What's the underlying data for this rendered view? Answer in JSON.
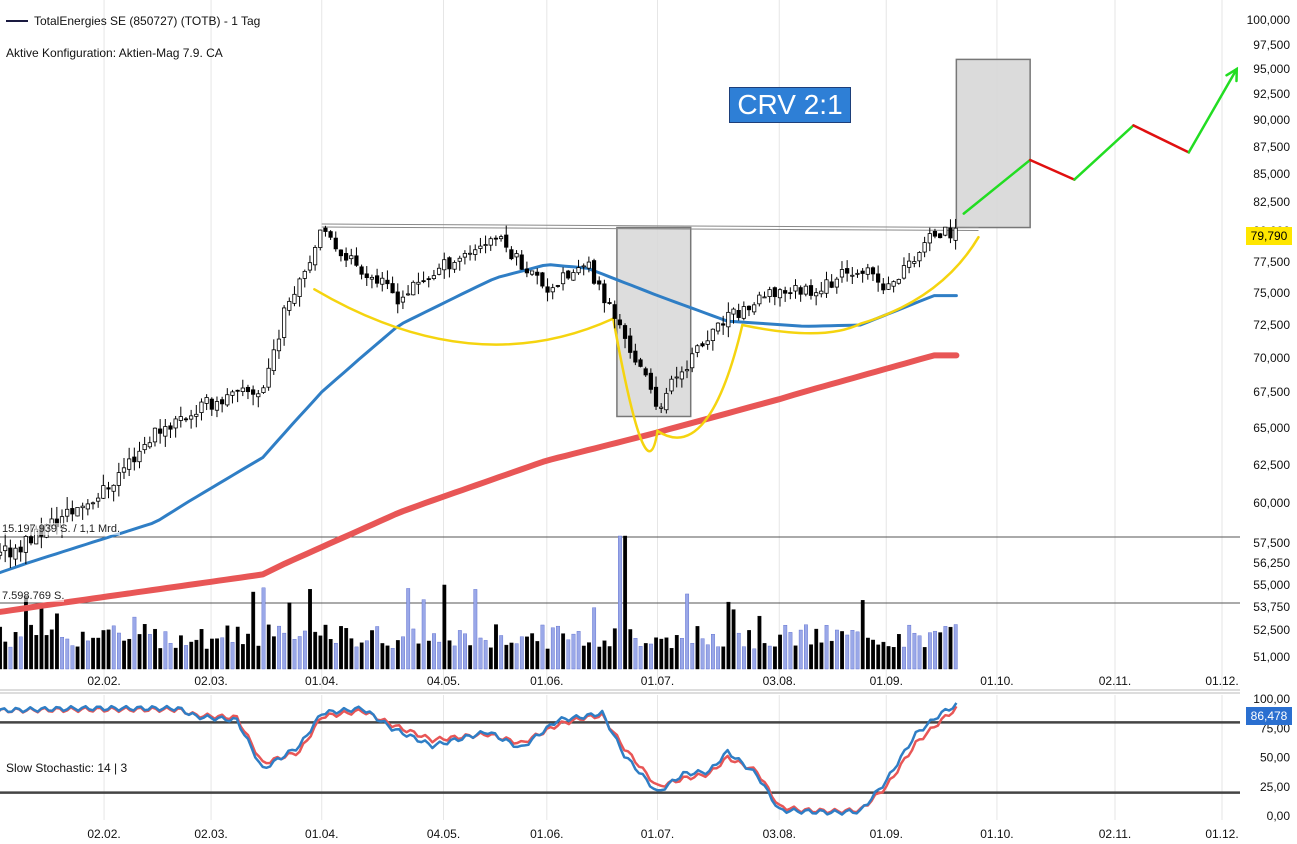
{
  "header": {
    "instrument": "TotalEnergies SE (850727) (TOTB) - 1 Tag",
    "config": "Aktive Konfiguration: Aktien-Mag 7.9. CA"
  },
  "annotation": {
    "crv": "CRV 2:1"
  },
  "price_tag": "79,790",
  "stoch_tag": "86,478",
  "stoch_label": "Slow Stochastic: 14 | 3",
  "volume": {
    "label_high": "15.197.939 S. / 1,1 Mrd.",
    "label_mid": "7.598.769 S."
  },
  "colors": {
    "sma_blue": "#2f7ec5",
    "sma_red": "#e85656",
    "cup": "#f5d40f",
    "target_up": "#22dd22",
    "target_down": "#e01010",
    "stoch_k": "#2f7ec5",
    "stoch_d": "#e85656",
    "vol_up": "#9aa8e8",
    "vol_down": "#000000",
    "price_tag_bg": "#ffe600",
    "stoch_tag_bg": "#2a6fd0"
  },
  "chart_data": [
    {
      "type": "candlestick",
      "title": "TotalEnergies SE (850727) (TOTB) - 1 Tag",
      "x_ticks": [
        "02.02.",
        "02.03.",
        "01.04.",
        "04.05.",
        "01.06.",
        "01.07.",
        "03.08.",
        "01.09.",
        "01.10.",
        "02.11.",
        "01.12."
      ],
      "y_ticks": [
        "100,000",
        "97,500",
        "95,000",
        "92,500",
        "90,000",
        "87,500",
        "85,000",
        "82,500",
        "80,000",
        "77,500",
        "75,000",
        "72,500",
        "70,000",
        "67,500",
        "65,000",
        "62,500",
        "60,000",
        "57,500",
        "56,250",
        "55,000",
        "53,750",
        "52,500",
        "51,000"
      ],
      "last_price": 79.79,
      "close_keypoints": [
        [
          "02.01.",
          56.2
        ],
        [
          "02.02.",
          60.8
        ],
        [
          "16.02.",
          64.8
        ],
        [
          "02.03.",
          66.8
        ],
        [
          "16.03.",
          67.7
        ],
        [
          "23.03.",
          74.5
        ],
        [
          "01.04.",
          79.8
        ],
        [
          "11.04.",
          77.2
        ],
        [
          "22.04.",
          74.6
        ],
        [
          "04.05.",
          77.2
        ],
        [
          "18.05.",
          79.6
        ],
        [
          "01.06.",
          75.4
        ],
        [
          "12.06.",
          77.2
        ],
        [
          "20.06.",
          72.8
        ],
        [
          "01.07.",
          66.5
        ],
        [
          "08.07.",
          69.4
        ],
        [
          "20.07.",
          73.0
        ],
        [
          "03.08.",
          75.2
        ],
        [
          "14.08.",
          75.4
        ],
        [
          "25.08.",
          77.2
        ],
        [
          "01.09.",
          75.2
        ],
        [
          "14.09.",
          79.8
        ]
      ],
      "resistance": {
        "from": [
          "01.04.",
          80.6
        ],
        "to": [
          "20.09.",
          80.3
        ]
      },
      "sma_blue_keypoints": [
        [
          "02.01.",
          55.5
        ],
        [
          "16.02.",
          58.8
        ],
        [
          "16.03.",
          63.0
        ],
        [
          "01.04.",
          67.5
        ],
        [
          "22.04.",
          72.5
        ],
        [
          "18.05.",
          76.2
        ],
        [
          "01.06.",
          77.3
        ],
        [
          "12.06.",
          77.0
        ],
        [
          "01.07.",
          74.8
        ],
        [
          "20.07.",
          72.8
        ],
        [
          "10.08.",
          72.4
        ],
        [
          "25.08.",
          72.5
        ],
        [
          "14.09.",
          74.8
        ]
      ],
      "sma_red_keypoints": [
        [
          "02.01.",
          53.4
        ],
        [
          "16.03.",
          55.6
        ],
        [
          "22.04.",
          59.4
        ],
        [
          "01.06.",
          62.8
        ],
        [
          "01.07.",
          64.7
        ],
        [
          "03.08.",
          67.0
        ],
        [
          "14.09.",
          70.2
        ]
      ],
      "target_box": {
        "from": "20.09.",
        "to": "10.10.",
        "low": 80.3,
        "high": 96.0
      },
      "consolidation_box": {
        "from": "20.06.",
        "to": "10.07.",
        "low": 65.8,
        "high": 80.3
      },
      "target_path": [
        [
          "22.09.",
          81.5,
          "up"
        ],
        [
          "10.10.",
          86.3,
          "down"
        ],
        [
          "22.10.",
          84.5,
          "up"
        ],
        [
          "07.11.",
          89.5,
          "down"
        ],
        [
          "22.11.",
          87.0,
          "up"
        ],
        [
          "05.12.",
          95.0,
          "up"
        ]
      ]
    },
    {
      "type": "bar",
      "title": "Volume",
      "levels": [
        "15.197.939 S. / 1,1 Mrd.",
        "7.598.769 S."
      ]
    },
    {
      "type": "line",
      "title": "Slow Stochastic: 14 | 3",
      "x_ticks": [
        "02.02.",
        "02.03.",
        "01.04.",
        "04.05.",
        "01.06.",
        "01.07.",
        "03.08.",
        "01.09.",
        "01.10.",
        "02.11.",
        "01.12."
      ],
      "y_ticks": [
        "100,00",
        "75,00",
        "50,00",
        "25,00",
        "0,00"
      ],
      "y_range": [
        0,
        100
      ],
      "guide_levels": [
        80,
        20
      ],
      "last_value": 86.478,
      "k_keypoints": [
        [
          "02.01.",
          90
        ],
        [
          "26.01.",
          92
        ],
        [
          "22.02.",
          92
        ],
        [
          "27.02.",
          85
        ],
        [
          "09.03.",
          82
        ],
        [
          "16.03.",
          40
        ],
        [
          "26.03.",
          60
        ],
        [
          "01.04.",
          88
        ],
        [
          "12.04.",
          92
        ],
        [
          "20.04.",
          75
        ],
        [
          "01.05.",
          60
        ],
        [
          "16.05.",
          72
        ],
        [
          "25.05.",
          58
        ],
        [
          "04.06.",
          82
        ],
        [
          "11.06.",
          85
        ],
        [
          "16.06.",
          88
        ],
        [
          "22.06.",
          52
        ],
        [
          "01.07.",
          20
        ],
        [
          "08.07.",
          36
        ],
        [
          "15.07.",
          38
        ],
        [
          "20.07.",
          55
        ],
        [
          "28.07.",
          35
        ],
        [
          "03.08.",
          5
        ],
        [
          "09.08.",
          4
        ],
        [
          "18.08.",
          3
        ],
        [
          "25.08.",
          4
        ],
        [
          "01.09.",
          30
        ],
        [
          "09.09.",
          70
        ],
        [
          "16.09.",
          88
        ],
        [
          "20.09.",
          95
        ]
      ],
      "d_keypoints": [
        [
          "02.01.",
          90
        ],
        [
          "26.01.",
          91
        ],
        [
          "22.02.",
          91
        ],
        [
          "27.02.",
          86
        ],
        [
          "09.03.",
          84
        ],
        [
          "16.03.",
          45
        ],
        [
          "26.03.",
          55
        ],
        [
          "01.04.",
          85
        ],
        [
          "12.04.",
          90
        ],
        [
          "20.04.",
          78
        ],
        [
          "01.05.",
          65
        ],
        [
          "16.05.",
          70
        ],
        [
          "25.05.",
          62
        ],
        [
          "04.06.",
          78
        ],
        [
          "11.06.",
          84
        ],
        [
          "16.06.",
          86
        ],
        [
          "22.06.",
          58
        ],
        [
          "01.07.",
          25
        ],
        [
          "08.07.",
          32
        ],
        [
          "15.07.",
          36
        ],
        [
          "20.07.",
          50
        ],
        [
          "28.07.",
          38
        ],
        [
          "03.08.",
          8
        ],
        [
          "09.08.",
          5
        ],
        [
          "18.08.",
          4
        ],
        [
          "25.08.",
          5
        ],
        [
          "01.09.",
          25
        ],
        [
          "09.09.",
          62
        ],
        [
          "16.09.",
          82
        ],
        [
          "20.09.",
          92
        ]
      ]
    }
  ]
}
